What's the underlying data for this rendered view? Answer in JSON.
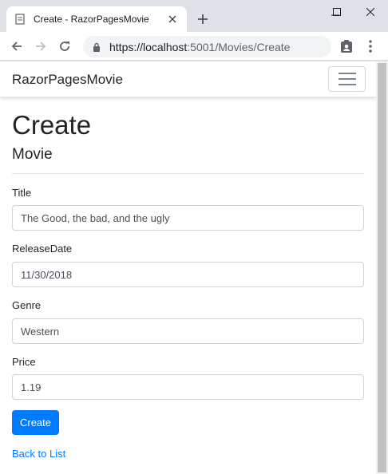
{
  "browser": {
    "tab_title": "Create - RazorPagesMovie",
    "url_host": "https://localhost",
    "url_rest": ":5001/Movies/Create"
  },
  "site": {
    "brand": "RazorPagesMovie"
  },
  "page": {
    "heading": "Create",
    "subheading": "Movie",
    "fields": [
      {
        "label": "Title",
        "value": "The Good, the bad, and the ugly"
      },
      {
        "label": "ReleaseDate",
        "value": "11/30/2018"
      },
      {
        "label": "Genre",
        "value": "Western"
      },
      {
        "label": "Price",
        "value": "1.19"
      }
    ],
    "submit_label": "Create",
    "back_link": "Back to List"
  },
  "colors": {
    "primary": "#007bff",
    "chrome_bg": "#dee1e6"
  }
}
